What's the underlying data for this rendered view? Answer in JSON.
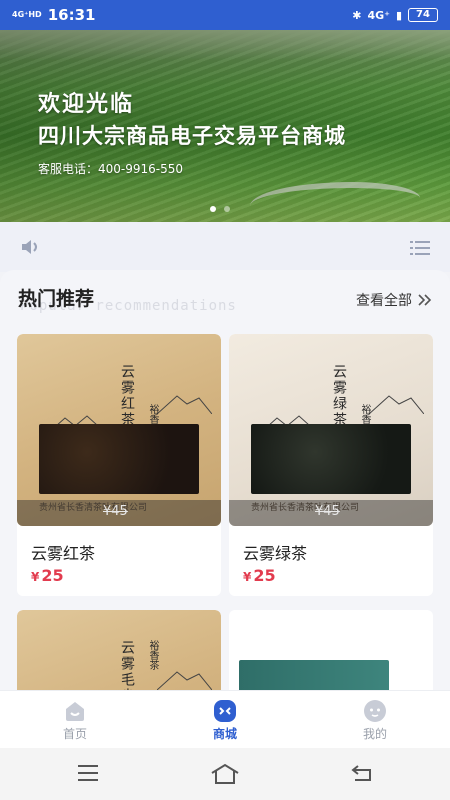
{
  "status_bar": {
    "network": "4G⁺HD",
    "time": "16:31",
    "right_network": "4G⁺",
    "battery": "74"
  },
  "banner": {
    "title": "欢迎光临",
    "subtitle": "四川大宗商品电子交易平台商城",
    "phone": "客服电话：400-9916-550",
    "active_dot": 0
  },
  "notice": {
    "speaker_icon": "speaker-icon",
    "menu_icon": "list-menu-icon"
  },
  "section": {
    "title": "热门推荐",
    "subtitle": "Popular recommendations",
    "more": "查看全部"
  },
  "products": [
    {
      "name": "云雾红茶",
      "price": "25",
      "original_price": "¥45",
      "currency": "¥",
      "package_label": "云雾红茶",
      "package_sub": "裕香茶",
      "company": "贵州省长香清茶叶有限公司"
    },
    {
      "name": "云雾绿茶",
      "price": "25",
      "original_price": "¥45",
      "currency": "¥",
      "package_label": "云雾绿茶",
      "package_sub": "裕香茶",
      "company": "贵州省长香清茶叶有限公司"
    },
    {
      "package_label": "云雾毛尖",
      "package_sub": "裕香茶"
    }
  ],
  "tabs": [
    {
      "label": "首页",
      "icon": "home-icon",
      "active": false
    },
    {
      "label": "商城",
      "icon": "shop-icon",
      "active": true
    },
    {
      "label": "我的",
      "icon": "profile-icon",
      "active": false
    }
  ],
  "colors": {
    "accent": "#2f5fd0",
    "price": "#e23b4e",
    "inactive": "#9aa0ab"
  }
}
